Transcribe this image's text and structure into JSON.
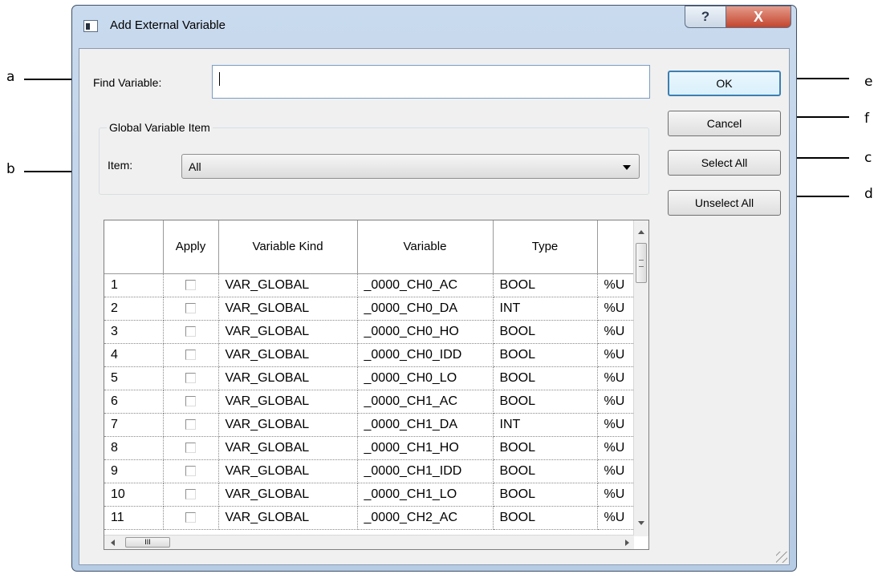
{
  "callouts": {
    "a": "a",
    "b": "b",
    "c": "c",
    "d": "d",
    "e": "e",
    "f": "f"
  },
  "window": {
    "title": "Add External Variable",
    "help_glyph": "?",
    "close_glyph": "X"
  },
  "find": {
    "label": "Find Variable:",
    "value": ""
  },
  "group": {
    "legend": "Global Variable Item",
    "item_label": "Item:",
    "item_value": "All"
  },
  "buttons": {
    "ok": "OK",
    "cancel": "Cancel",
    "select_all": "Select All",
    "unselect_all": "Unselect All"
  },
  "table": {
    "headers": [
      "",
      "Apply",
      "Variable Kind",
      "Variable",
      "Type",
      ""
    ],
    "rows": [
      {
        "no": "1",
        "apply": false,
        "kind": "VAR_GLOBAL",
        "variable": "_0000_CH0_AC",
        "type": "BOOL",
        "addr": "%U"
      },
      {
        "no": "2",
        "apply": false,
        "kind": "VAR_GLOBAL",
        "variable": "_0000_CH0_DA",
        "type": "INT",
        "addr": "%U"
      },
      {
        "no": "3",
        "apply": false,
        "kind": "VAR_GLOBAL",
        "variable": "_0000_CH0_HO",
        "type": "BOOL",
        "addr": "%U"
      },
      {
        "no": "4",
        "apply": false,
        "kind": "VAR_GLOBAL",
        "variable": "_0000_CH0_IDD",
        "type": "BOOL",
        "addr": "%U"
      },
      {
        "no": "5",
        "apply": false,
        "kind": "VAR_GLOBAL",
        "variable": "_0000_CH0_LO",
        "type": "BOOL",
        "addr": "%U"
      },
      {
        "no": "6",
        "apply": false,
        "kind": "VAR_GLOBAL",
        "variable": "_0000_CH1_AC",
        "type": "BOOL",
        "addr": "%U"
      },
      {
        "no": "7",
        "apply": false,
        "kind": "VAR_GLOBAL",
        "variable": "_0000_CH1_DA",
        "type": "INT",
        "addr": "%U"
      },
      {
        "no": "8",
        "apply": false,
        "kind": "VAR_GLOBAL",
        "variable": "_0000_CH1_HO",
        "type": "BOOL",
        "addr": "%U"
      },
      {
        "no": "9",
        "apply": false,
        "kind": "VAR_GLOBAL",
        "variable": "_0000_CH1_IDD",
        "type": "BOOL",
        "addr": "%U"
      },
      {
        "no": "10",
        "apply": false,
        "kind": "VAR_GLOBAL",
        "variable": "_0000_CH1_LO",
        "type": "BOOL",
        "addr": "%U"
      },
      {
        "no": "11",
        "apply": false,
        "kind": "VAR_GLOBAL",
        "variable": "_0000_CH2_AC",
        "type": "BOOL",
        "addr": "%U"
      }
    ]
  },
  "scrollbar": {
    "h_thumb_glyph": "III"
  }
}
